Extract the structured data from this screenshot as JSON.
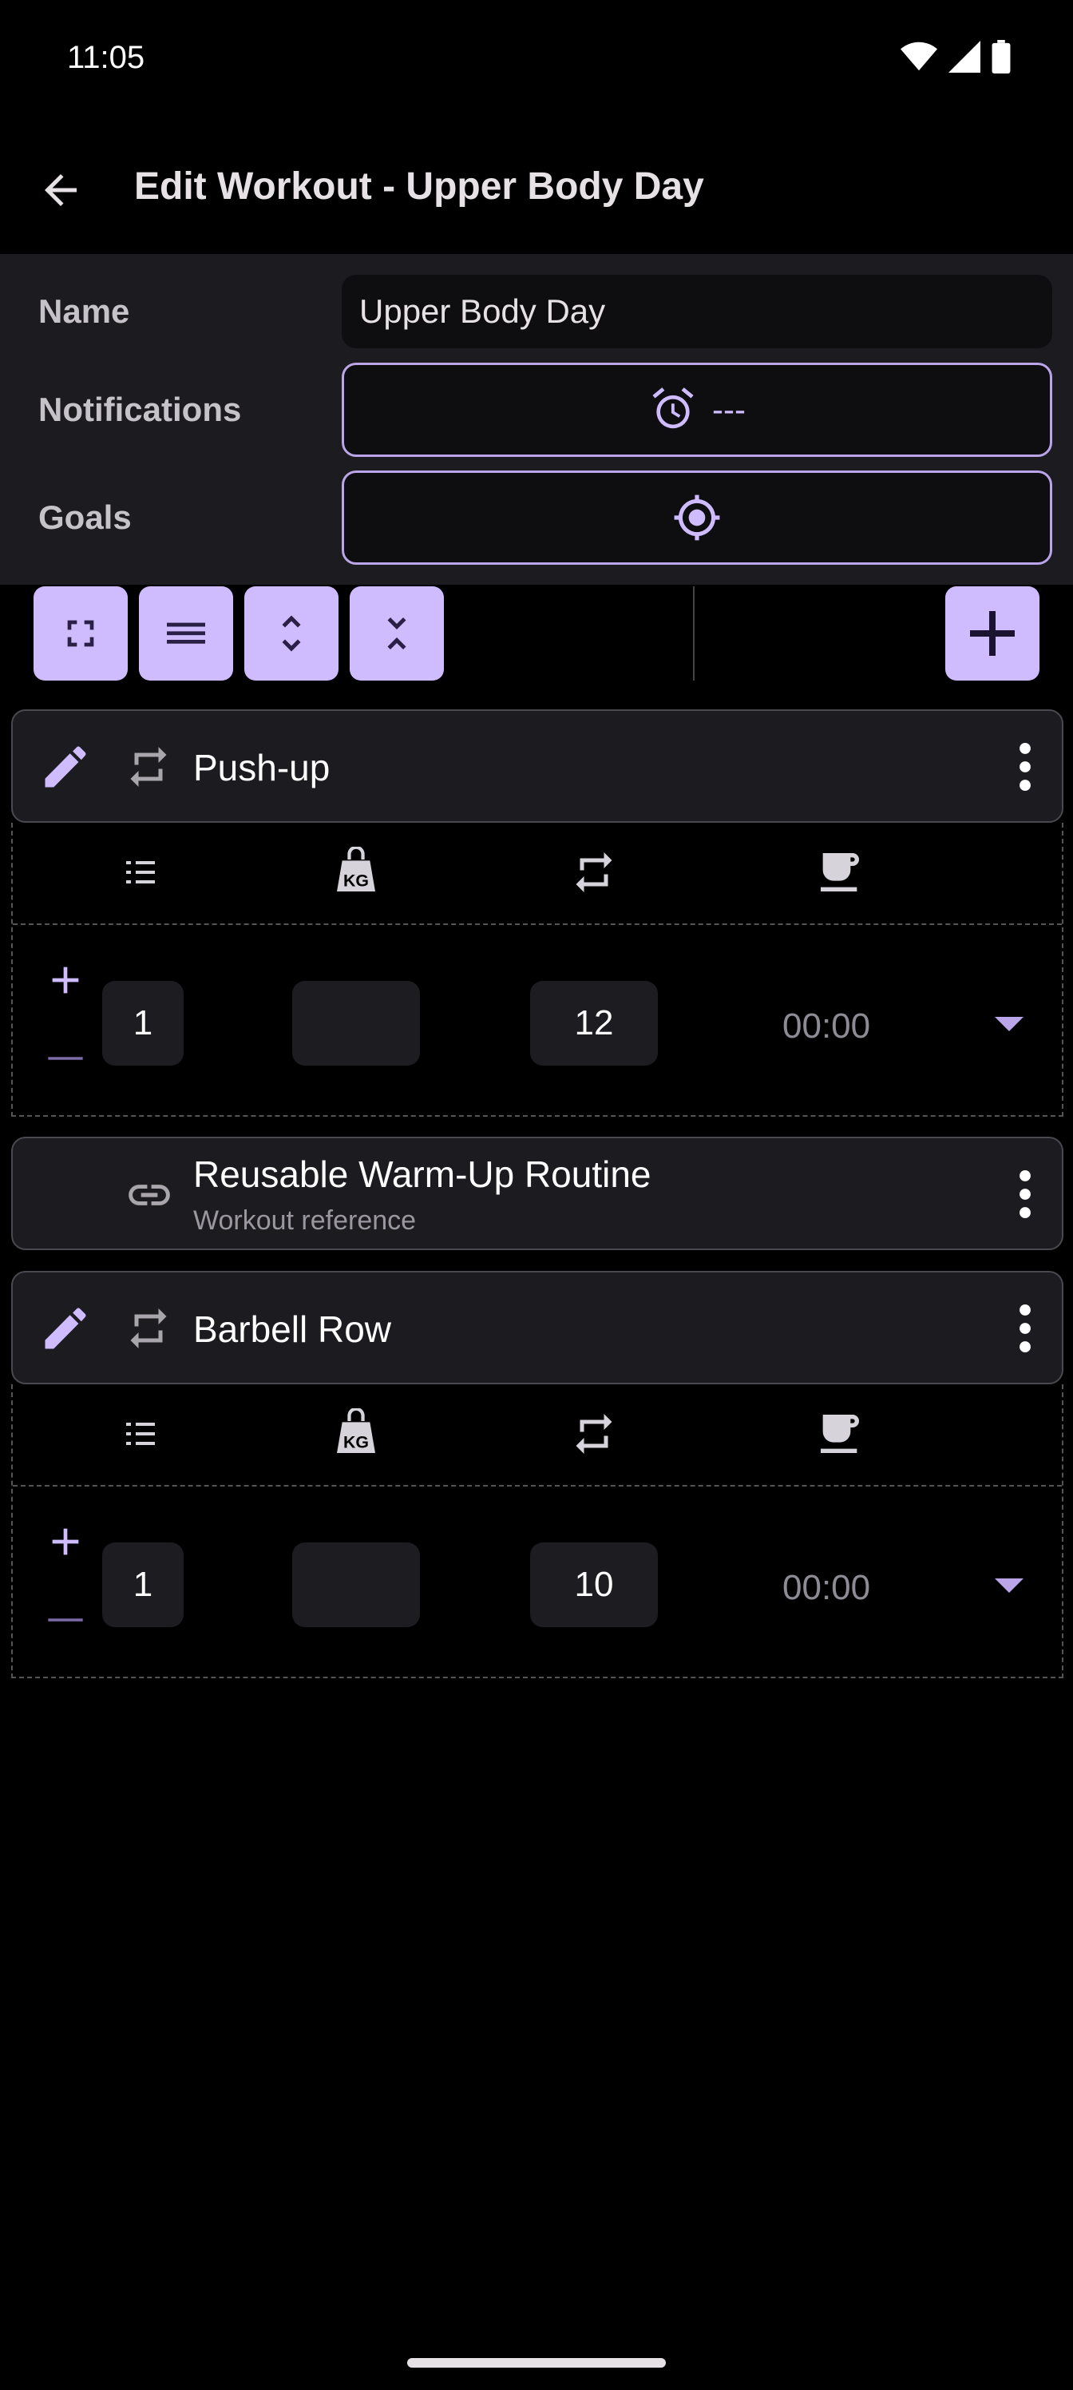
{
  "status_bar": {
    "time": "11:05"
  },
  "app_bar": {
    "title": "Edit Workout - Upper Body Day"
  },
  "header": {
    "name_label": "Name",
    "name_value": "Upper Body Day",
    "notifications_label": "Notifications",
    "notifications_value": "---",
    "goals_label": "Goals"
  },
  "colors": {
    "accent": "#cfbcff",
    "surface": "#1c1b1f",
    "background": "#000000"
  },
  "exercises": [
    {
      "title": "Push-up",
      "set": {
        "number": "1",
        "weight": "",
        "reps": "12",
        "rest": "00:00"
      }
    },
    {
      "title": "Reusable Warm-Up Routine",
      "subtitle": "Workout reference"
    },
    {
      "title": "Barbell Row",
      "set": {
        "number": "1",
        "weight": "",
        "reps": "10",
        "rest": "00:00"
      }
    }
  ]
}
